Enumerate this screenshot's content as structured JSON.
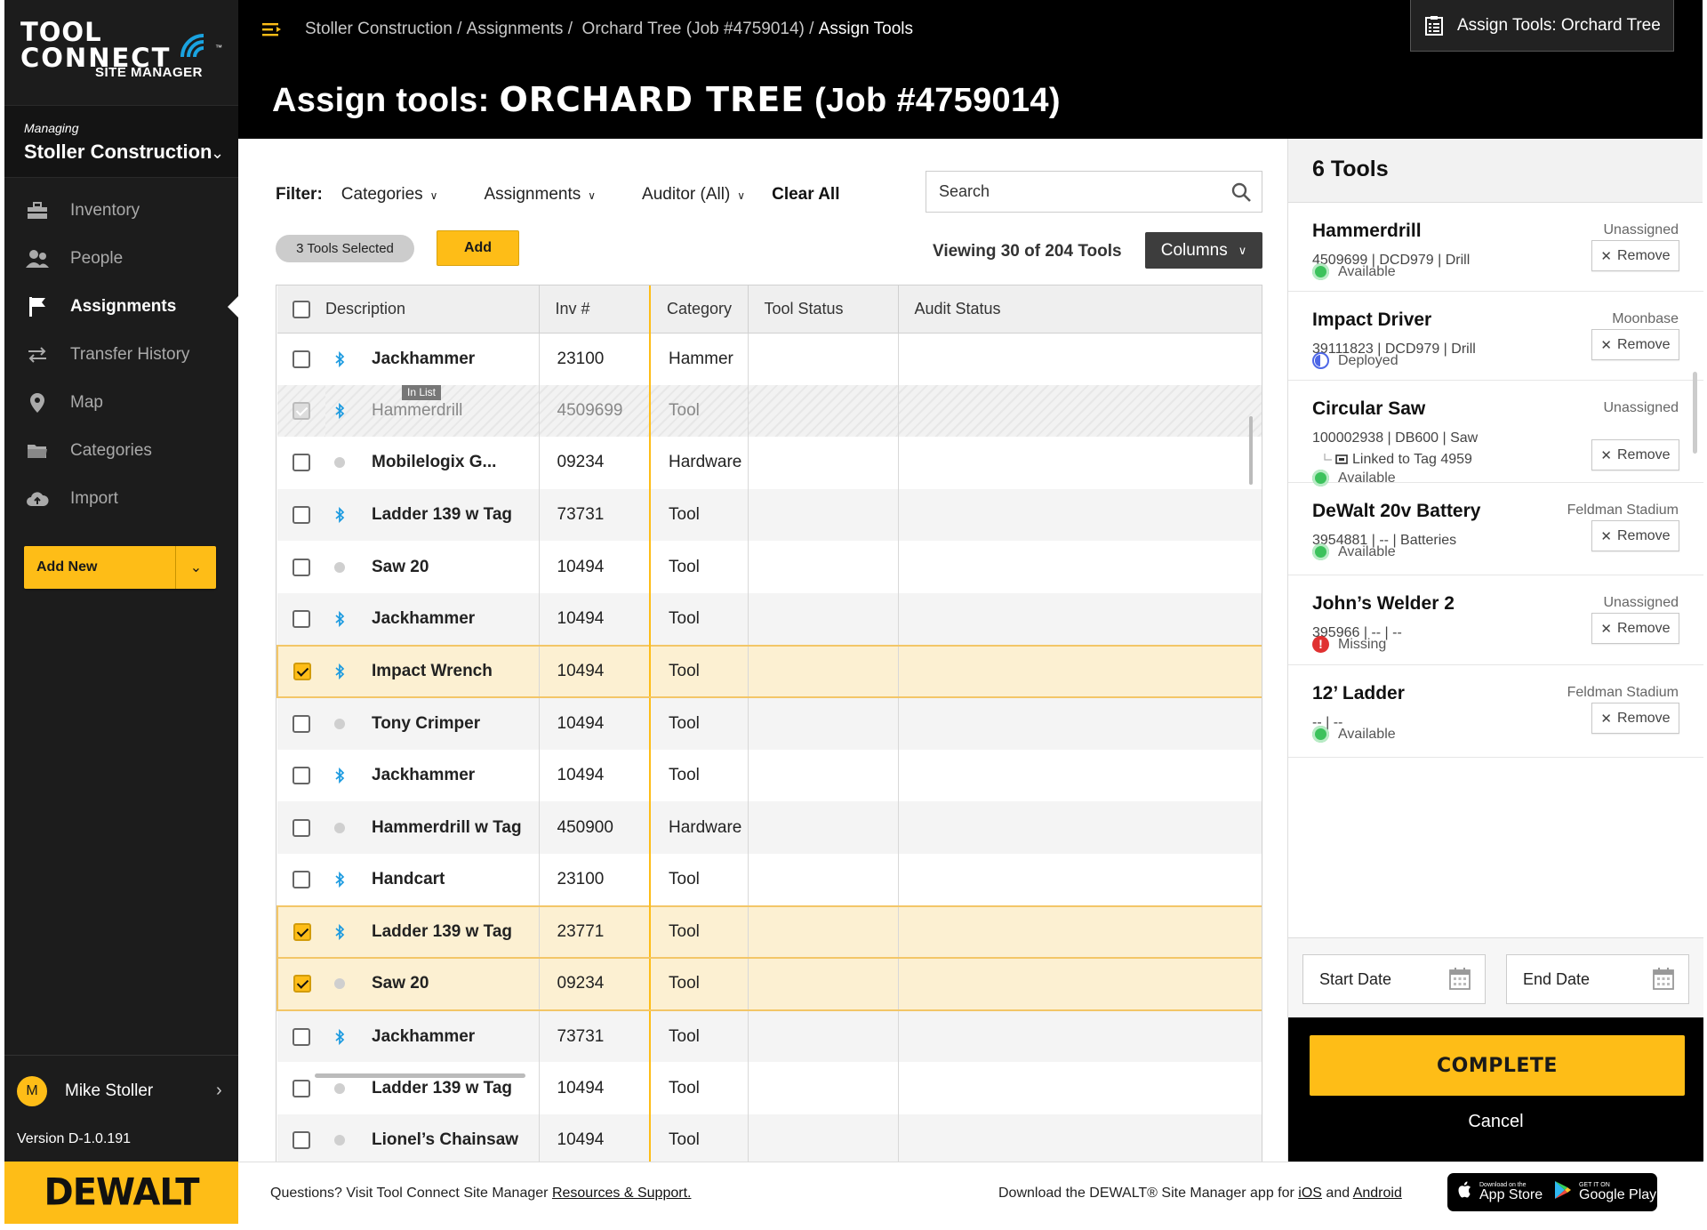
{
  "brand": {
    "logo_line1": "TOOL",
    "logo_line2": "CONNECT",
    "logo_sub": "SITE MANAGER",
    "logo_tm": "™",
    "footer_logo": "DEWALT",
    "accent_color": "#febd17",
    "dark_color": "#1c1c1c"
  },
  "sidebar": {
    "managing_label": "Managing",
    "company": "Stoller Construction",
    "items": [
      {
        "label": "Inventory",
        "icon": "toolbox-icon",
        "active": false
      },
      {
        "label": "People",
        "icon": "people-icon",
        "active": false
      },
      {
        "label": "Assignments",
        "icon": "flag-icon",
        "active": true
      },
      {
        "label": "Transfer History",
        "icon": "transfer-arrows-icon",
        "active": false
      },
      {
        "label": "Map",
        "icon": "map-pin-icon",
        "active": false
      },
      {
        "label": "Categories",
        "icon": "folder-icon",
        "active": false
      },
      {
        "label": "Import",
        "icon": "cloud-upload-icon",
        "active": false
      }
    ],
    "add_new": "Add New",
    "user_initial": "M",
    "user_name": "Mike Stoller",
    "version": "Version D-1.0.191"
  },
  "header": {
    "breadcrumb": [
      "Stoller Construction",
      "Assignments",
      "Orchard Tree (Job #4759014)",
      "Assign Tools"
    ],
    "title_prefix": "Assign tools:",
    "title_name": "ORCHARD TREE",
    "title_job": "(Job #4759014)",
    "assign_button": "Assign Tools: Orchard Tree"
  },
  "filters": {
    "label": "Filter:",
    "categories": "Categories",
    "assignments": "Assignments",
    "auditor": "Auditor (All)",
    "clear_all": "Clear All",
    "search_placeholder": "Search"
  },
  "toolbar": {
    "selected_pill": "3 Tools Selected",
    "add_button": "Add",
    "viewing": "Viewing 30 of 204 Tools",
    "columns_button": "Columns"
  },
  "table": {
    "columns": [
      "Description",
      "Inv #",
      "Category",
      "Tool Status",
      "Audit Status"
    ],
    "in_list_badge": "In List",
    "rows": [
      {
        "checked": false,
        "icon": "bluetooth",
        "name": "Jackhammer",
        "inv": "23100",
        "category": "Hammer",
        "state": "normal"
      },
      {
        "checked": true,
        "icon": "bluetooth",
        "name": "Hammerdrill",
        "inv": "4509699",
        "category": "Tool",
        "state": "inlist"
      },
      {
        "checked": false,
        "icon": "dot",
        "name": "Mobilelogix G...",
        "inv": "09234",
        "category": "Hardware",
        "state": "normal"
      },
      {
        "checked": false,
        "icon": "bluetooth",
        "name": "Ladder 139 w Tag",
        "inv": "73731",
        "category": "Tool",
        "state": "alt"
      },
      {
        "checked": false,
        "icon": "dot",
        "name": "Saw 20",
        "inv": "10494",
        "category": "Tool",
        "state": "normal"
      },
      {
        "checked": false,
        "icon": "bluetooth",
        "name": "Jackhammer",
        "inv": "10494",
        "category": "Tool",
        "state": "alt"
      },
      {
        "checked": true,
        "icon": "bluetooth",
        "name": "Impact Wrench",
        "inv": "10494",
        "category": "Tool",
        "state": "sel"
      },
      {
        "checked": false,
        "icon": "dot",
        "name": "Tony Crimper",
        "inv": "10494",
        "category": "Tool",
        "state": "alt"
      },
      {
        "checked": false,
        "icon": "bluetooth",
        "name": "Jackhammer",
        "inv": "10494",
        "category": "Tool",
        "state": "normal"
      },
      {
        "checked": false,
        "icon": "dot",
        "name": "Hammerdrill w Tag",
        "inv": "450900",
        "category": "Hardware",
        "state": "alt"
      },
      {
        "checked": false,
        "icon": "bluetooth",
        "name": "Handcart",
        "inv": "23100",
        "category": "Tool",
        "state": "normal"
      },
      {
        "checked": true,
        "icon": "bluetooth",
        "name": "Ladder 139 w Tag",
        "inv": "23771",
        "category": "Tool",
        "state": "sel"
      },
      {
        "checked": true,
        "icon": "dot",
        "name": "Saw 20",
        "inv": "09234",
        "category": "Tool",
        "state": "sel"
      },
      {
        "checked": false,
        "icon": "bluetooth",
        "name": "Jackhammer",
        "inv": "73731",
        "category": "Tool",
        "state": "alt"
      },
      {
        "checked": false,
        "icon": "dot",
        "name": "Ladder 139 w Tag",
        "inv": "10494",
        "category": "Tool",
        "state": "normal"
      },
      {
        "checked": false,
        "icon": "dot",
        "name": "Lionel’s Chainsaw",
        "inv": "10494",
        "category": "Tool",
        "state": "alt"
      }
    ]
  },
  "panel": {
    "title": "6 Tools",
    "remove_label": "Remove",
    "items": [
      {
        "name": "Hammerdrill",
        "location": "Unassigned",
        "meta": "4509699  |  DCD979  |  Drill",
        "status": "Available",
        "status_type": "ok"
      },
      {
        "name": "Impact Driver",
        "location": "Moonbase",
        "meta": "39111823  |  DCD979  |  Drill",
        "status": "Deployed",
        "status_type": "dep"
      },
      {
        "name": "Circular Saw",
        "location": "Unassigned",
        "meta": "100002938  |  DB600  |  Saw",
        "linked": "Linked to Tag 4959",
        "status": "Available",
        "status_type": "ok"
      },
      {
        "name": "DeWalt 20v Battery",
        "location": "Feldman Stadium",
        "meta": "3954881 |  --  |  Batteries",
        "status": "Available",
        "status_type": "ok"
      },
      {
        "name": "John’s Welder 2",
        "location": "Unassigned",
        "meta": "395966  |  --  |  --",
        "status": "Missing",
        "status_type": "miss"
      },
      {
        "name": "12’ Ladder",
        "location": "Feldman Stadium",
        "meta": "--  |  --",
        "status": "Available",
        "status_type": "ok"
      }
    ],
    "start_date": "Start Date",
    "end_date": "End Date",
    "complete": "COMPLETE",
    "cancel": "Cancel"
  },
  "footer": {
    "questions_prefix": "Questions? Visit Tool Connect Site Manager",
    "resources_link": "Resources & Support.",
    "download_prefix": "Download the DEWALT® Site Manager app for",
    "ios_link": "iOS",
    "and": "and",
    "android_link": "Android",
    "appstore_small": "Download on the",
    "appstore_big": "App Store",
    "google_small": "GET IT ON",
    "google_big": "Google Play"
  }
}
